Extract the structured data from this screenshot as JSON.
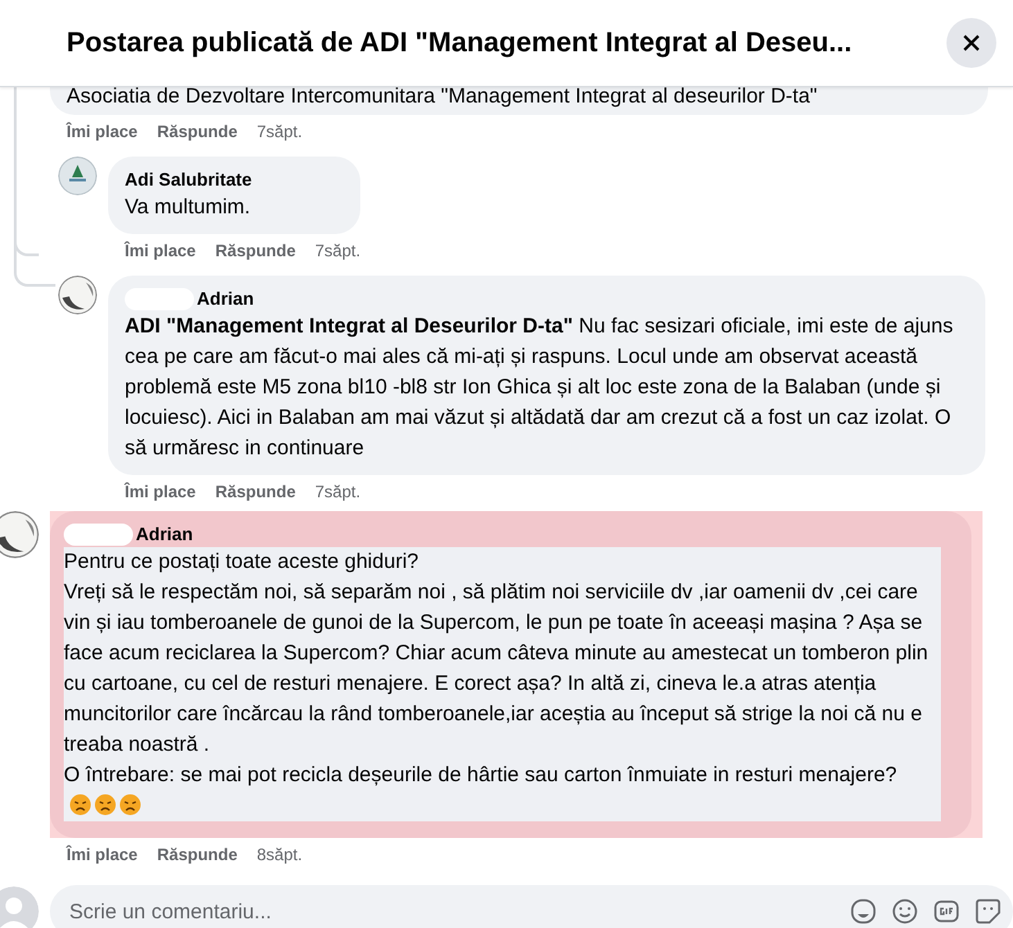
{
  "dialog": {
    "title": "Postarea publicată de ADI \"Management Integrat al Deseu..."
  },
  "comments": [
    {
      "kind": "cut",
      "text": "Asociatia de Dezvoltare Intercomunitara \"Management Integrat al deseurilor D-ta\"",
      "actions": {
        "like": "Îmi place",
        "reply": "Răspunde",
        "time": "7săpt."
      }
    },
    {
      "kind": "reply",
      "avatar": {
        "kind": "logo"
      },
      "author": "Adi Salubritate",
      "author_redacted": false,
      "text": "Va multumim.",
      "trailing_emoji": false,
      "highlighted": false,
      "actions": {
        "like": "Îmi place",
        "reply": "Răspunde",
        "time": "7săpt."
      }
    },
    {
      "kind": "reply",
      "avatar": {
        "kind": "photo"
      },
      "author": "Adrian",
      "author_redacted": true,
      "text": "**ADI \"Management Integrat al Deseurilor D-ta\"** Nu fac sesizari oficiale, imi este de ajuns cea pe care am făcut-o mai ales că mi-ați și raspuns. Locul unde am observat această problemă este M5 zona bl10 -bl8 str Ion Ghica și alt loc este zona de la Balaban (unde și locuiesc). Aici in Balaban am mai văzut și altădată dar am crezut că a fost un caz izolat. O să urmăresc in continuare",
      "trailing_emoji": false,
      "highlighted": false,
      "actions": {
        "like": "Îmi place",
        "reply": "Răspunde",
        "time": "7săpt."
      }
    },
    {
      "kind": "top",
      "avatar": {
        "kind": "photo"
      },
      "author": "Adrian",
      "author_redacted": true,
      "text": "Pentru ce postați toate aceste ghiduri?\nVreți să le respectăm noi, să separăm noi , să plătim noi serviciile dv ,iar oamenii dv ,cei care vin și iau tomberoanele de gunoi de la Supercom, le pun pe toate în aceeași mașina ? Așa se face acum reciclarea la Supercom? Chiar acum câteva minute au amestecat un tomberon plin cu cartoane, cu cel de resturi menajere. E corect așa? In altă zi, cineva le.a atras atenția muncitorilor care încărcau la rând tomberoanele,iar aceștia au început să strige la noi că nu e treaba noastră .\nO întrebare: se mai pot recicla deșeurile de hârtie sau carton înmuiate in resturi menajere?",
      "trailing_emoji": true,
      "highlighted": true,
      "actions": {
        "like": "Îmi place",
        "reply": "Răspunde",
        "time": "8săpt."
      }
    }
  ],
  "comment_box": {
    "placeholder": "Scrie un comentariu..."
  }
}
